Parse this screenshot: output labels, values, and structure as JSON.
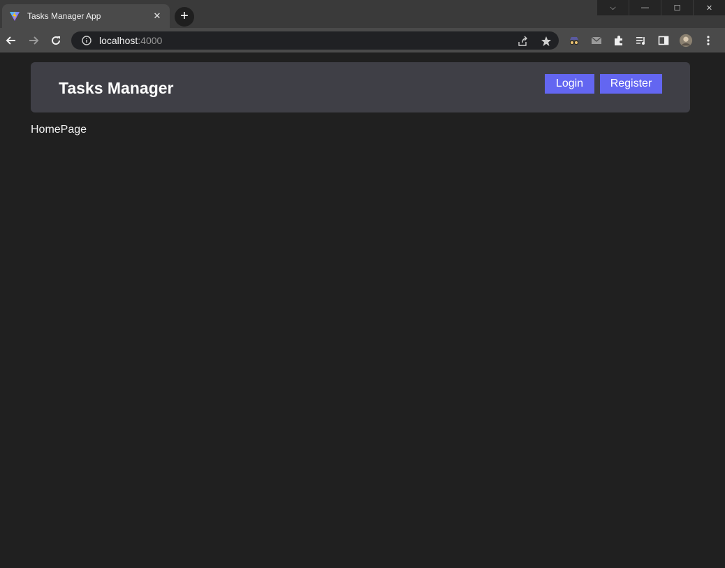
{
  "browser": {
    "tab_title": "Tasks Manager App",
    "tab_close": "✕",
    "new_tab": "+",
    "url_host": "localhost",
    "url_port": ":4000",
    "window_controls": {
      "dropdown": "⌵",
      "minimize": "—",
      "maximize": "☐",
      "close": "✕"
    },
    "icons": [
      "back-arrow-icon",
      "forward-arrow-icon",
      "reload-icon",
      "info-icon",
      "share-icon",
      "star-icon",
      "incognito-icon",
      "mail-icon",
      "puzzle-icon",
      "media-icon",
      "sidepanel-icon",
      "profile-avatar",
      "kebab-menu-icon"
    ]
  },
  "header": {
    "title": "Tasks Manager",
    "login_label": "Login",
    "register_label": "Register"
  },
  "main": {
    "text": "HomePage"
  },
  "colors": {
    "page_bg": "#202020",
    "header_bg": "#3f3f46",
    "accent": "#6366f1"
  }
}
